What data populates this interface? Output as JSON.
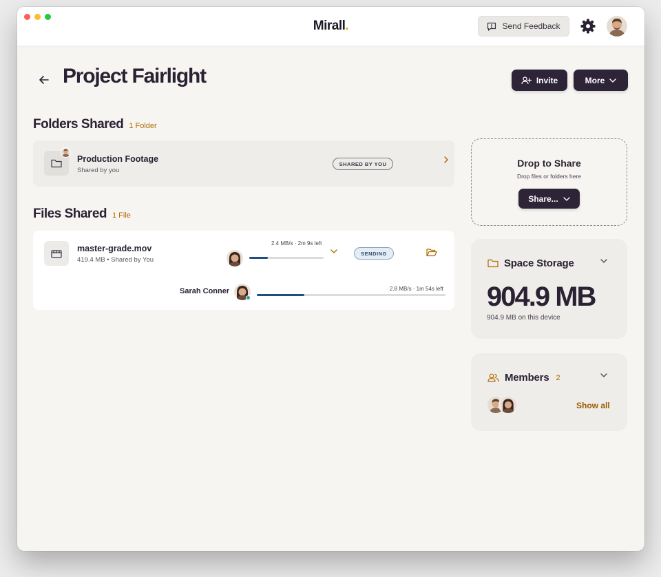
{
  "app": {
    "logo_text": "Mirall",
    "logo_dot": ".",
    "accent_color": "#e8a200"
  },
  "header": {
    "feedback_label": "Send Feedback"
  },
  "page": {
    "title": "Project Fairlight",
    "invite_label": "Invite",
    "more_label": "More"
  },
  "folders_section": {
    "title": "Folders Shared",
    "count": "1 Folder",
    "items": [
      {
        "name": "Production Footage",
        "subtitle": "Shared by you",
        "badge": "SHARED BY YOU"
      }
    ]
  },
  "files_section": {
    "title": "Files Shared",
    "count": "1 File",
    "items": [
      {
        "name": "master-grade.mov",
        "subtitle": "419.4 MB • Shared by You",
        "speed": "2.4 MB/s · 2m 9s left",
        "progress": 0.25,
        "status": "SENDING",
        "recipients": [
          {
            "name": "Sarah Conner",
            "speed": "2.8 MB/s · 1m 54s left",
            "progress": 0.25
          }
        ]
      }
    ]
  },
  "drop_zone": {
    "title": "Drop to Share",
    "subtitle": "Drop files or folders here",
    "button_label": "Share..."
  },
  "storage": {
    "title": "Space Storage",
    "value": "904.9 MB",
    "subtitle": "904.9 MB on this device"
  },
  "members": {
    "title": "Members",
    "count": "2",
    "show_all_label": "Show all"
  }
}
